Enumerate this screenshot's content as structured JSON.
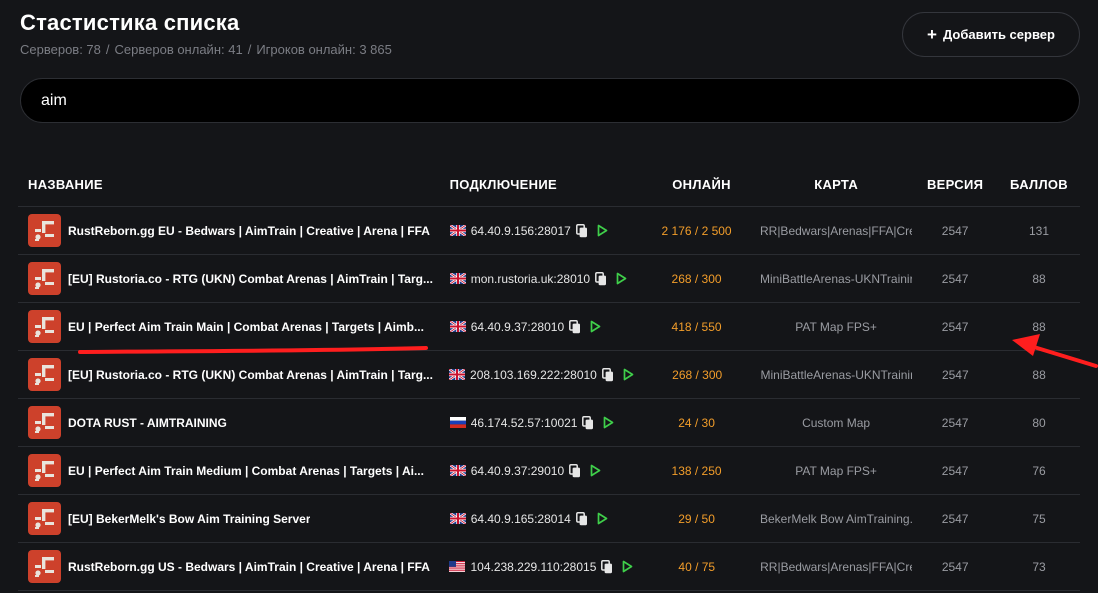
{
  "header": {
    "title": "Стастистика списка",
    "stats": {
      "servers": "Серверов: 78",
      "servers_online": "Серверов онлайн: 41",
      "players_online": "Игроков онлайн: 3 865",
      "separator": "/"
    },
    "add_button_label": "Добавить сервер",
    "add_button_icon": "+"
  },
  "search": {
    "value": "aim"
  },
  "table": {
    "columns": {
      "name": "НАЗВАНИЕ",
      "connection": "ПОДКЛЮЧЕНИЕ",
      "online": "ОНЛАЙН",
      "map": "КАРТА",
      "version": "ВЕРСИЯ",
      "points": "БАЛЛОВ"
    },
    "rows": [
      {
        "name": "RustReborn.gg EU - Bedwars | AimTrain | Creative | Arena | FFA",
        "flag": "gb-flag-icon",
        "address": "64.40.9.156:28017",
        "online": "2 176 / 2 500",
        "map": "RR|Bedwars|Arenas|FFA|Creat",
        "version": "2547",
        "points": "131"
      },
      {
        "name": "[EU] Rustoria.co - RTG (UKN) Combat Arenas | AimTrain | Targ...",
        "flag": "gb-flag-icon",
        "address": "mon.rustoria.uk:28010",
        "online": "268 / 300",
        "map": "MiniBattleArenas-UKNTrainir",
        "version": "2547",
        "points": "88"
      },
      {
        "name": "EU | Perfect Aim Train Main | Combat Arenas | Targets | Aimb...",
        "flag": "gb-flag-icon",
        "address": "64.40.9.37:28010",
        "online": "418 / 550",
        "map": "PAT Map FPS+",
        "version": "2547",
        "points": "88"
      },
      {
        "name": "[EU] Rustoria.co - RTG (UKN) Combat Arenas | AimTrain | Targ...",
        "flag": "gb-flag-icon",
        "address": "208.103.169.222:28010",
        "online": "268 / 300",
        "map": "MiniBattleArenas-UKNTrainir",
        "version": "2547",
        "points": "88"
      },
      {
        "name": "DOTA RUST - AIMTRAINING",
        "flag": "ru-flag-icon",
        "address": "46.174.52.57:10021",
        "online": "24 / 30",
        "map": "Custom Map",
        "version": "2547",
        "points": "80"
      },
      {
        "name": "EU | Perfect Aim Train Medium | Combat Arenas | Targets | Ai...",
        "flag": "gb-flag-icon",
        "address": "64.40.9.37:29010",
        "online": "138 / 250",
        "map": "PAT Map FPS+",
        "version": "2547",
        "points": "76"
      },
      {
        "name": "[EU] BekerMelk's Bow Aim Training Server",
        "flag": "gb-flag-icon",
        "address": "64.40.9.165:28014",
        "online": "29 / 50",
        "map": "BekerMelk Bow AimTraining.r",
        "version": "2547",
        "points": "75"
      },
      {
        "name": "RustReborn.gg US - Bedwars | AimTrain | Creative | Arena | FFA",
        "flag": "us-flag-icon",
        "address": "104.238.229.110:28015",
        "online": "40 / 75",
        "map": "RR|Bedwars|Arenas|FFA|Creat",
        "version": "2547",
        "points": "73"
      }
    ]
  },
  "colors": {
    "background": "#141518",
    "online": "#f29d2a",
    "play": "#3fcf4a",
    "rust_logo": "#cd412b",
    "annotation": "#ff1e1e"
  }
}
